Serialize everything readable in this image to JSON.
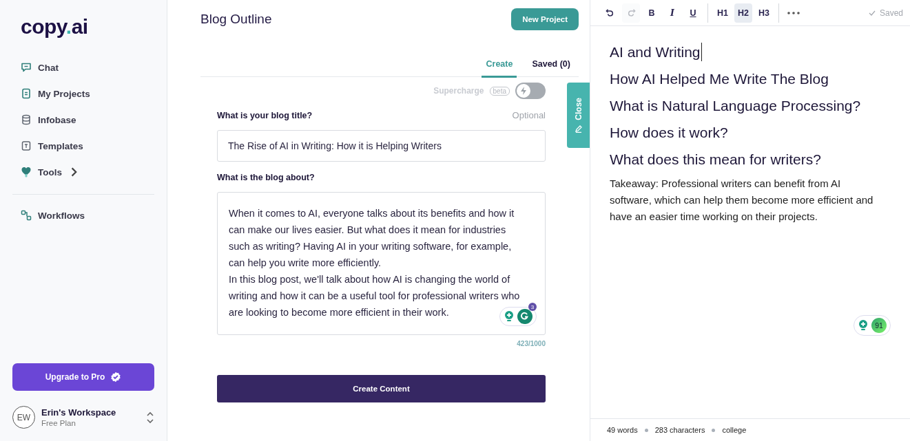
{
  "sidebar": {
    "logo": {
      "text": "copy",
      "dot": ".",
      "suffix": "ai"
    },
    "items": [
      {
        "label": "Chat",
        "kind": "chat",
        "chevron": false
      },
      {
        "label": "My Projects",
        "kind": "doc",
        "chevron": false
      },
      {
        "label": "Infobase",
        "kind": "db",
        "chevron": false
      },
      {
        "label": "Templates",
        "kind": "tpl",
        "chevron": false
      },
      {
        "label": "Tools",
        "kind": "tools",
        "chevron": true
      }
    ],
    "items_after_divider": [
      {
        "label": "Workflows",
        "kind": "flow",
        "chevron": false
      }
    ],
    "upgrade_button": "Upgrade to Pro",
    "workspace": {
      "initials": "EW",
      "name": "Erin's Workspace",
      "plan": "Free Plan"
    }
  },
  "main": {
    "title": "Blog Outline",
    "new_button": "New Project",
    "tabs": [
      {
        "label": "Create",
        "selected": true
      },
      {
        "label": "Saved (0)",
        "selected": false
      }
    ],
    "supercharge": {
      "label": "Supercharge",
      "badge": "beta",
      "on": false
    },
    "close_tab": "Close",
    "fields": [
      {
        "kind": "input",
        "label": "What is your blog title?",
        "hint": "Optional",
        "value": "The Rise of AI in Writing: How it is Helping Writers"
      },
      {
        "kind": "textarea",
        "label": "What is the blog about?",
        "value": "When it comes to AI, everyone talks about its benefits and how it can make our lives easier. But what does it mean for industries such as writing? Having AI in your writing software, for example, can help you write more efficiently.\nIn this blog post, we'll talk about how AI is changing the world of writing and how it can be a useful tool for professional writers who are looking to become more efficient in their work.",
        "grammar_count": "3",
        "counter": "423/1000"
      }
    ],
    "create_button": "Create Content"
  },
  "editor": {
    "toolbar": [
      {
        "kind": "undo",
        "disabled": false
      },
      {
        "kind": "redo",
        "disabled": true
      },
      {
        "kind": "bold",
        "label": "B"
      },
      {
        "kind": "italic",
        "label": "I"
      },
      {
        "kind": "underline",
        "label": "U"
      },
      {
        "kind": "sep"
      },
      {
        "kind": "heading",
        "label": "H1",
        "selected": false
      },
      {
        "kind": "heading",
        "label": "H2",
        "selected": true
      },
      {
        "kind": "heading",
        "label": "H3",
        "selected": false
      },
      {
        "kind": "sep"
      },
      {
        "kind": "more"
      }
    ],
    "saved": "Saved",
    "blocks": [
      {
        "kind": "heading",
        "text": "AI and Writing"
      },
      {
        "kind": "heading",
        "text": "How AI Helped Me Write The Blog"
      },
      {
        "kind": "heading",
        "text": "What is Natural Language Processing?"
      },
      {
        "kind": "heading",
        "text": "How does it work?"
      },
      {
        "kind": "heading",
        "text": "What does this mean for writers?"
      },
      {
        "kind": "paragraph",
        "text": "Takeaway: Professional writers can benefit from AI software, which can help them become more efficient and have an easier time working on their projects."
      }
    ],
    "grammar_score": "91",
    "status": [
      "49 words",
      "283 characters",
      "college"
    ]
  }
}
